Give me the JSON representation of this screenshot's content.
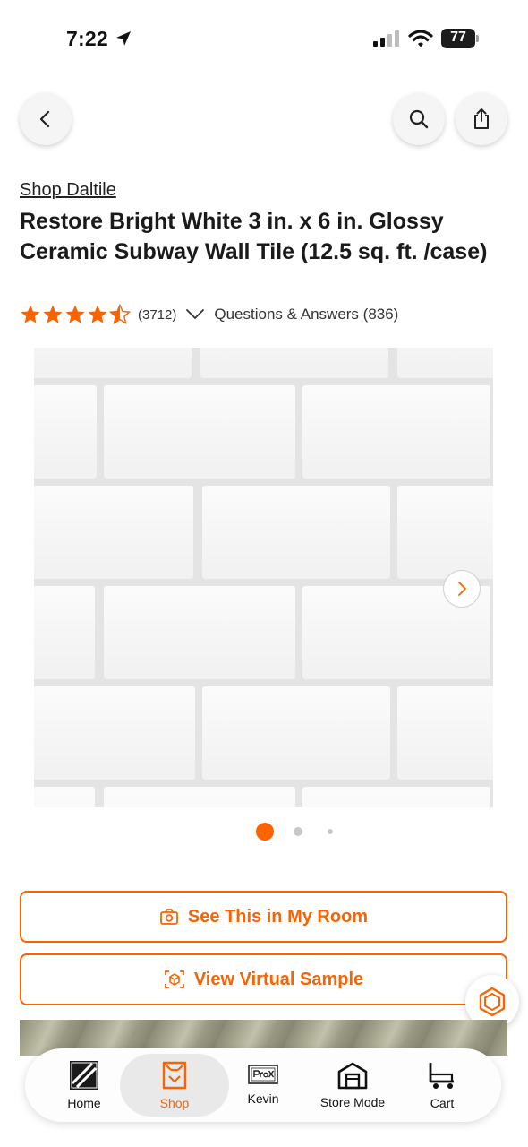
{
  "status_bar": {
    "time": "7:22",
    "battery": "77"
  },
  "nav": {
    "back_icon": "chevron-left-icon",
    "search_icon": "search-icon",
    "share_icon": "share-icon"
  },
  "product": {
    "brand_link": "Shop Daltile",
    "title": "Restore Bright White 3 in. x 6 in. Glossy Ceramic Subway Wall Tile (12.5 sq. ft. /case)",
    "rating": 4.5,
    "review_count": "(3712)",
    "qa_label": "Questions & Answers (836)"
  },
  "gallery": {
    "image_count": 3,
    "active_index": 0
  },
  "actions": {
    "see_in_room": "See This in My Room",
    "virtual_sample": "View Virtual Sample"
  },
  "tabs": [
    {
      "label": "Home",
      "icon": "home-depot-logo-icon"
    },
    {
      "label": "Shop",
      "icon": "shop-icon",
      "active": true
    },
    {
      "label": "Kevin",
      "icon": "pro-x-icon"
    },
    {
      "label": "Store Mode",
      "icon": "store-icon"
    },
    {
      "label": "Cart",
      "icon": "cart-icon"
    }
  ],
  "colors": {
    "accent": "#f96302",
    "text": "#1a1a1a",
    "tile": "#ececec"
  }
}
